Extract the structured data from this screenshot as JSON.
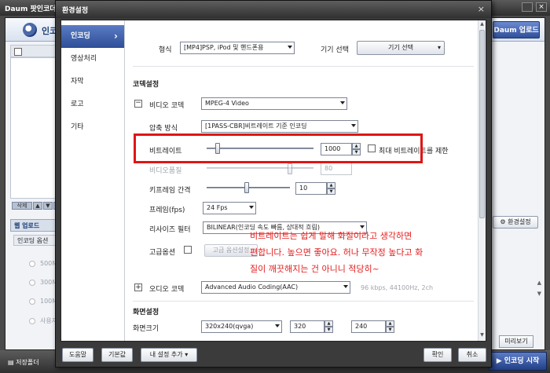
{
  "background_app": {
    "title": "Daum 팟인코더",
    "brand": "인코",
    "upload_button": "Daum 업로드",
    "delete_button": "삭제",
    "web_upload_tab": "웹 업로드",
    "encode_options": "인코딩 옵션",
    "radio_options": [
      "500M",
      "300M",
      "100M",
      "사용자"
    ],
    "env_settings_button": "환경설정",
    "preview_button": "미리보기",
    "save_folder": "저장폴더",
    "start_button": "인코딩 시작"
  },
  "dialog": {
    "title": "환경설정",
    "close": "×",
    "sidebar": [
      "인코딩",
      "영상처리",
      "자막",
      "로고",
      "기타"
    ],
    "format_label": "형식",
    "format_value": "[MP4]PSP, iPod 및 핸드폰용",
    "device_label": "기기 선택",
    "device_button": "기기 선택",
    "codec_section": "코덱설정",
    "video_codec_label": "비디오 코덱",
    "video_codec_value": "MPEG-4 Video",
    "compression_label": "압축 방식",
    "compression_value": "[1PASS-CBR]비트레이트 기준 인코딩",
    "bitrate_label": "비트레이트",
    "bitrate_value": "1000",
    "bitrate_limit_label": "최대 비트레이트를 제한",
    "video_quality_label": "비디오품질",
    "video_quality_value": "80",
    "keyframe_label": "키프레임 간격",
    "keyframe_value": "10",
    "fps_label": "프레임(fps)",
    "fps_value": "24 Fps",
    "resize_filter_label": "리사이즈 필터",
    "resize_filter_value": "BILINEAR(인코딩 속도 빠름, 상대적 흐림)",
    "advanced_label": "고급옵션",
    "advanced_button": "고급 옵션설정",
    "audio_codec_label": "오디오 코덱",
    "audio_codec_value": "Advanced Audio Coding(AAC)",
    "audio_info": "96 kbps, 44100Hz, 2ch",
    "screen_section": "화면설정",
    "screen_size_label": "화면크기",
    "screen_size_value": "320x240(qvga)",
    "width_value": "320",
    "height_value": "240",
    "footer": {
      "help": "도움말",
      "default": "기본값",
      "my_settings": "내 설정 추가",
      "ok": "확인",
      "cancel": "취소"
    }
  },
  "annotation": [
    "비트레이트는 쉽게 말해 화질이라고 생각하면",
    "편합니다. 높으면 좋아요. 허나 무작정 높다고 화",
    "질이 깨끗해지는 건 아니니 적당히~"
  ],
  "colors": {
    "annotation_red": "#e31c1c",
    "active_tab": "#3c5ea8"
  },
  "sliders": {
    "bitrate_level": 0.1,
    "keyframe_level": 0.48
  }
}
